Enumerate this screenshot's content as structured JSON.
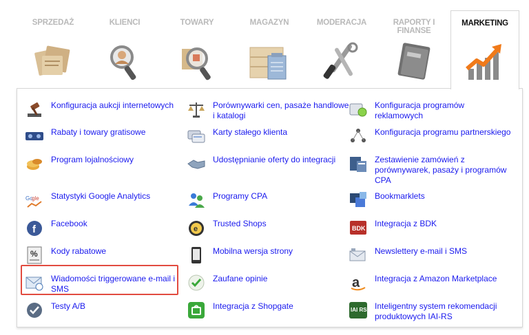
{
  "tabs": [
    {
      "label": "SPRZEDAŻ",
      "icon": "documents-icon"
    },
    {
      "label": "KLIENCI",
      "icon": "client-search-icon"
    },
    {
      "label": "TOWARY",
      "icon": "product-search-icon"
    },
    {
      "label": "MAGAZYN",
      "icon": "warehouse-crate-icon"
    },
    {
      "label": "MODERACJA",
      "icon": "tools-icon"
    },
    {
      "label": "RAPORTY I FINANSE",
      "icon": "report-book-icon"
    },
    {
      "label": "MARKETING",
      "icon": "growth-chart-icon"
    }
  ],
  "active_tab": "MARKETING",
  "items": {
    "c1": [
      {
        "label": "Konfiguracja aukcji internetowych",
        "icon": "gavel-icon"
      },
      {
        "label": "Rabaty i towary gratisowe",
        "icon": "discount-icon"
      },
      {
        "label": "Program lojalnościowy",
        "icon": "coins-icon"
      },
      {
        "label": "Statystyki Google Analytics",
        "icon": "google-analytics-icon"
      },
      {
        "label": "Facebook",
        "icon": "facebook-icon"
      },
      {
        "label": "Kody rabatowe",
        "icon": "percent-code-icon"
      },
      {
        "label": "Wiadomości triggerowane e-mail i SMS",
        "icon": "email-clock-icon"
      },
      {
        "label": "Testy A/B",
        "icon": "ab-test-icon"
      }
    ],
    "c2": [
      {
        "label": "Porównywarki cen, pasaże handlowe i katalogi",
        "icon": "scales-icon"
      },
      {
        "label": "Karty stałego klienta",
        "icon": "loyalty-cards-icon"
      },
      {
        "label": "Udostępnianie oferty do integracji",
        "icon": "handshake-icon"
      },
      {
        "label": "Programy CPA",
        "icon": "users-cpa-icon"
      },
      {
        "label": "Trusted Shops",
        "icon": "trusted-shops-icon"
      },
      {
        "label": "Mobilna wersja strony",
        "icon": "mobile-phone-icon"
      },
      {
        "label": "Zaufane opinie",
        "icon": "checkmark-icon"
      },
      {
        "label": "Integracja z Shopgate",
        "icon": "shopgate-icon"
      }
    ],
    "c3": [
      {
        "label": "Konfiguracja programów reklamowych",
        "icon": "ad-program-icon"
      },
      {
        "label": "Konfiguracja programu partnerskiego",
        "icon": "partner-network-icon"
      },
      {
        "label": "Zestawienie zamówień z porównywarek, pasaży i programów CPA",
        "icon": "orders-summary-icon"
      },
      {
        "label": "Bookmarklets",
        "icon": "bookmarklets-icon"
      },
      {
        "label": "Integracja z BDK",
        "icon": "bdk-icon"
      },
      {
        "label": "Newslettery e-mail i SMS",
        "icon": "newsletter-icon"
      },
      {
        "label": "Integracja z Amazon Marketplace",
        "icon": "amazon-icon"
      },
      {
        "label": "Inteligentny system rekomendacji produktowych IAI-RS",
        "icon": "iai-rs-icon"
      }
    ]
  }
}
